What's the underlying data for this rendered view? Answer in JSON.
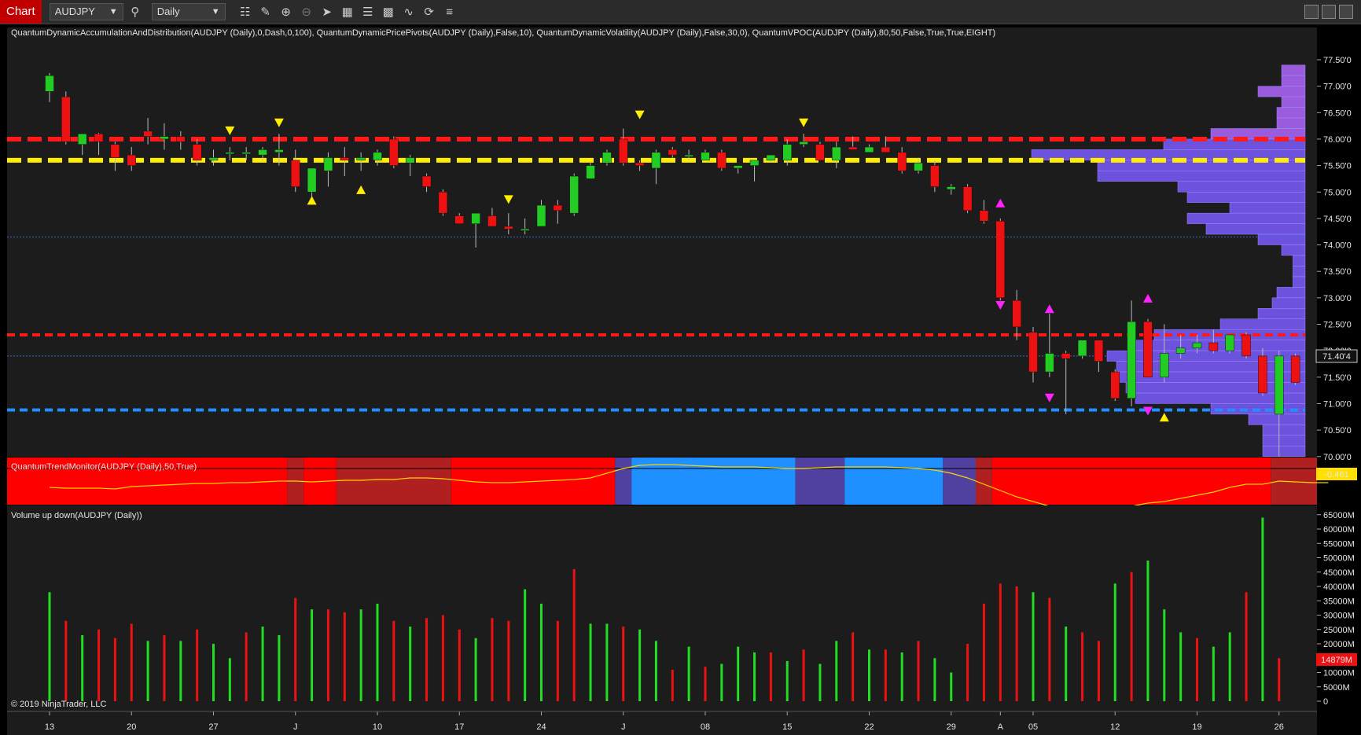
{
  "toolbar": {
    "tab_label": "Chart",
    "instrument": "AUDJPY",
    "period": "Daily"
  },
  "price_panel": {
    "indicator_text": "QuantumDynamicAccumulationAndDistribution(AUDJPY (Daily),0,Dash,0,100), QuantumDynamicPricePivots(AUDJPY (Daily),False,10), QuantumDynamicVolatility(AUDJPY (Daily),False,30,0), QuantumVPOC(AUDJPY (Daily),80,50,False,True,True,EIGHT)",
    "current_price_label": "71.40'4",
    "y_ticks": [
      "77.50'0",
      "77.00'0",
      "76.50'0",
      "76.00'0",
      "75.50'0",
      "75.00'0",
      "74.50'0",
      "74.00'0",
      "73.50'0",
      "73.00'0",
      "72.50'0",
      "72.00'0",
      "71.50'0",
      "71.00'0",
      "70.50'0",
      "70.00'0"
    ],
    "resistance_red": 76.0,
    "yellow_level": 75.6,
    "lower_red": 72.3,
    "blue_level": 70.88,
    "thin_blue_1": 74.15,
    "thin_blue_2": 71.9,
    "colors": {
      "up": "#22cc22",
      "down": "#ee1111",
      "red_line": "#ff1a1a",
      "yellow_line": "#ffee00",
      "blue_line": "#1e90ff",
      "vpoc": "#7b5cff",
      "vpoc_upper": "#b266ff"
    }
  },
  "trend_panel": {
    "title": "QuantumTrendMonitor(AUDJPY (Daily),50,True)",
    "value_label": "-0.461"
  },
  "volume_panel": {
    "title": "Volume up down(AUDJPY (Daily))",
    "copyright": "© 2019 NinjaTrader, LLC",
    "current_volume_label": "14879M",
    "y_ticks": [
      "65000M",
      "60000M",
      "55000M",
      "50000M",
      "45000M",
      "40000M",
      "35000M",
      "30000M",
      "25000M",
      "20000M",
      "15000M",
      "10000M",
      "5000M",
      "0"
    ]
  },
  "x_axis": {
    "labels": [
      "13",
      "20",
      "27",
      "J",
      "10",
      "17",
      "24",
      "J",
      "08",
      "15",
      "22",
      "29",
      "A",
      "05",
      "12",
      "19",
      "26"
    ]
  },
  "chart_data": {
    "type": "candlestick",
    "candles": [
      {
        "o": 76.9,
        "h": 77.25,
        "l": 76.7,
        "c": 77.2
      },
      {
        "o": 76.8,
        "h": 76.9,
        "l": 75.9,
        "c": 75.95
      },
      {
        "o": 75.9,
        "h": 76.1,
        "l": 75.7,
        "c": 76.1
      },
      {
        "o": 76.1,
        "h": 76.12,
        "l": 75.7,
        "c": 75.95
      },
      {
        "o": 75.9,
        "h": 75.95,
        "l": 75.4,
        "c": 75.65
      },
      {
        "o": 75.7,
        "h": 75.85,
        "l": 75.4,
        "c": 75.5
      },
      {
        "o": 76.15,
        "h": 76.4,
        "l": 75.9,
        "c": 76.05
      },
      {
        "o": 76.0,
        "h": 76.3,
        "l": 75.8,
        "c": 76.05
      },
      {
        "o": 76.05,
        "h": 76.15,
        "l": 75.8,
        "c": 75.95
      },
      {
        "o": 75.9,
        "h": 76.0,
        "l": 75.5,
        "c": 75.6
      },
      {
        "o": 75.6,
        "h": 75.8,
        "l": 75.5,
        "c": 75.65
      },
      {
        "o": 75.75,
        "h": 75.85,
        "l": 75.6,
        "c": 75.75
      },
      {
        "o": 75.75,
        "h": 75.85,
        "l": 75.6,
        "c": 75.75
      },
      {
        "o": 75.7,
        "h": 75.85,
        "l": 75.6,
        "c": 75.8
      },
      {
        "o": 75.75,
        "h": 76.1,
        "l": 75.5,
        "c": 75.8
      },
      {
        "o": 75.6,
        "h": 75.8,
        "l": 75.0,
        "c": 75.1
      },
      {
        "o": 75.0,
        "h": 75.45,
        "l": 74.85,
        "c": 75.45
      },
      {
        "o": 75.4,
        "h": 75.75,
        "l": 75.1,
        "c": 75.65
      },
      {
        "o": 75.65,
        "h": 75.85,
        "l": 75.3,
        "c": 75.6
      },
      {
        "o": 75.6,
        "h": 75.75,
        "l": 75.4,
        "c": 75.65
      },
      {
        "o": 75.6,
        "h": 75.8,
        "l": 75.5,
        "c": 75.75
      },
      {
        "o": 76.0,
        "h": 76.05,
        "l": 75.45,
        "c": 75.5
      },
      {
        "o": 75.55,
        "h": 75.7,
        "l": 75.3,
        "c": 75.65
      },
      {
        "o": 75.3,
        "h": 75.35,
        "l": 75.0,
        "c": 75.1
      },
      {
        "o": 75.0,
        "h": 75.05,
        "l": 74.55,
        "c": 74.6
      },
      {
        "o": 74.55,
        "h": 74.6,
        "l": 74.4,
        "c": 74.4
      },
      {
        "o": 74.4,
        "h": 74.6,
        "l": 73.95,
        "c": 74.6
      },
      {
        "o": 74.55,
        "h": 74.7,
        "l": 74.35,
        "c": 74.35
      },
      {
        "o": 74.35,
        "h": 74.6,
        "l": 74.2,
        "c": 74.3
      },
      {
        "o": 74.3,
        "h": 74.5,
        "l": 74.2,
        "c": 74.3
      },
      {
        "o": 74.35,
        "h": 74.85,
        "l": 74.35,
        "c": 74.75
      },
      {
        "o": 74.75,
        "h": 74.85,
        "l": 74.4,
        "c": 74.65
      },
      {
        "o": 74.6,
        "h": 75.35,
        "l": 74.55,
        "c": 75.3
      },
      {
        "o": 75.25,
        "h": 75.55,
        "l": 75.25,
        "c": 75.5
      },
      {
        "o": 75.55,
        "h": 75.8,
        "l": 75.5,
        "c": 75.75
      },
      {
        "o": 76.0,
        "h": 76.2,
        "l": 75.5,
        "c": 75.55
      },
      {
        "o": 75.55,
        "h": 75.6,
        "l": 75.4,
        "c": 75.5
      },
      {
        "o": 75.45,
        "h": 75.8,
        "l": 75.15,
        "c": 75.75
      },
      {
        "o": 75.8,
        "h": 75.85,
        "l": 75.65,
        "c": 75.7
      },
      {
        "o": 75.7,
        "h": 75.8,
        "l": 75.6,
        "c": 75.7
      },
      {
        "o": 75.6,
        "h": 75.8,
        "l": 75.6,
        "c": 75.75
      },
      {
        "o": 75.75,
        "h": 75.8,
        "l": 75.4,
        "c": 75.45
      },
      {
        "o": 75.45,
        "h": 75.5,
        "l": 75.35,
        "c": 75.5
      },
      {
        "o": 75.5,
        "h": 75.6,
        "l": 75.2,
        "c": 75.6
      },
      {
        "o": 75.6,
        "h": 75.7,
        "l": 75.55,
        "c": 75.7
      },
      {
        "o": 75.6,
        "h": 76.0,
        "l": 75.5,
        "c": 75.9
      },
      {
        "o": 75.9,
        "h": 76.1,
        "l": 75.85,
        "c": 75.95
      },
      {
        "o": 75.9,
        "h": 75.95,
        "l": 75.6,
        "c": 75.6
      },
      {
        "o": 75.6,
        "h": 75.95,
        "l": 75.45,
        "c": 75.85
      },
      {
        "o": 75.85,
        "h": 76.05,
        "l": 75.8,
        "c": 75.8
      },
      {
        "o": 75.75,
        "h": 75.9,
        "l": 75.75,
        "c": 75.85
      },
      {
        "o": 75.85,
        "h": 76.05,
        "l": 75.75,
        "c": 75.75
      },
      {
        "o": 75.75,
        "h": 75.85,
        "l": 75.35,
        "c": 75.4
      },
      {
        "o": 75.4,
        "h": 75.65,
        "l": 75.35,
        "c": 75.55
      },
      {
        "o": 75.5,
        "h": 75.6,
        "l": 75.0,
        "c": 75.1
      },
      {
        "o": 75.05,
        "h": 75.15,
        "l": 74.95,
        "c": 75.1
      },
      {
        "o": 75.1,
        "h": 75.15,
        "l": 74.6,
        "c": 74.65
      },
      {
        "o": 74.65,
        "h": 74.85,
        "l": 74.4,
        "c": 74.45
      },
      {
        "o": 74.45,
        "h": 74.5,
        "l": 72.95,
        "c": 73.0
      },
      {
        "o": 72.95,
        "h": 73.15,
        "l": 72.2,
        "c": 72.45
      },
      {
        "o": 72.35,
        "h": 72.45,
        "l": 71.4,
        "c": 71.6
      },
      {
        "o": 71.6,
        "h": 72.7,
        "l": 71.5,
        "c": 71.95
      },
      {
        "o": 71.95,
        "h": 72.0,
        "l": 70.8,
        "c": 71.85
      },
      {
        "o": 71.9,
        "h": 72.2,
        "l": 71.85,
        "c": 72.2
      },
      {
        "o": 72.2,
        "h": 72.2,
        "l": 71.6,
        "c": 71.8
      },
      {
        "o": 71.6,
        "h": 71.65,
        "l": 71.05,
        "c": 71.1
      },
      {
        "o": 71.1,
        "h": 72.95,
        "l": 70.95,
        "c": 72.55
      },
      {
        "o": 72.55,
        "h": 72.6,
        "l": 71.5,
        "c": 71.5
      },
      {
        "o": 71.5,
        "h": 72.5,
        "l": 71.4,
        "c": 71.95
      },
      {
        "o": 71.95,
        "h": 72.3,
        "l": 71.85,
        "c": 72.05
      },
      {
        "o": 72.05,
        "h": 72.3,
        "l": 71.95,
        "c": 72.15
      },
      {
        "o": 72.15,
        "h": 72.4,
        "l": 71.95,
        "c": 72.0
      },
      {
        "o": 72.0,
        "h": 72.3,
        "l": 71.95,
        "c": 72.3
      },
      {
        "o": 72.3,
        "h": 72.35,
        "l": 71.85,
        "c": 71.9
      },
      {
        "o": 71.9,
        "h": 72.05,
        "l": 71.15,
        "c": 71.2
      },
      {
        "o": 70.8,
        "h": 72.0,
        "l": 70.0,
        "c": 71.9
      },
      {
        "o": 71.9,
        "h": 71.95,
        "l": 71.35,
        "c": 71.4
      }
    ],
    "volume_k": [
      38,
      28,
      23,
      25,
      22,
      27,
      21,
      23,
      21,
      25,
      20,
      15,
      24,
      26,
      23,
      36,
      32,
      32,
      31,
      32,
      34,
      28,
      26,
      29,
      30,
      25,
      22,
      29,
      28,
      39,
      34,
      28,
      46,
      27,
      27,
      26,
      25,
      21,
      11,
      19,
      12,
      13,
      19,
      17,
      17,
      14,
      18,
      13,
      21,
      24,
      18,
      18,
      17,
      21,
      15,
      10,
      20,
      34,
      41,
      40,
      38,
      36,
      26,
      24,
      21,
      41,
      45,
      49,
      32,
      24,
      22,
      19,
      24,
      38,
      64,
      15
    ],
    "volume_up": [
      1,
      0,
      1,
      0,
      0,
      0,
      1,
      0,
      1,
      0,
      1,
      1,
      0,
      1,
      1,
      0,
      1,
      0,
      0,
      1,
      1,
      0,
      1,
      0,
      0,
      0,
      1,
      0,
      0,
      1,
      1,
      0,
      0,
      1,
      1,
      0,
      1,
      1,
      0,
      1,
      0,
      1,
      1,
      1,
      0,
      1,
      0,
      1,
      1,
      0,
      1,
      0,
      1,
      0,
      1,
      1,
      0,
      0,
      0,
      0,
      1,
      0,
      1,
      0,
      0,
      1,
      0,
      1,
      1,
      1,
      0,
      1,
      1,
      0,
      1,
      0
    ],
    "vpoc_profile": [
      {
        "p": 77.3,
        "w": 0.25
      },
      {
        "p": 77.1,
        "w": 0.25
      },
      {
        "p": 76.9,
        "w": 0.5
      },
      {
        "p": 76.7,
        "w": 0.25
      },
      {
        "p": 76.5,
        "w": 0.3
      },
      {
        "p": 76.3,
        "w": 0.3
      },
      {
        "p": 76.1,
        "w": 1.0
      },
      {
        "p": 75.9,
        "w": 1.5
      },
      {
        "p": 75.7,
        "w": 2.9
      },
      {
        "p": 75.5,
        "w": 2.2
      },
      {
        "p": 75.3,
        "w": 2.2
      },
      {
        "p": 75.1,
        "w": 1.35
      },
      {
        "p": 74.9,
        "w": 1.25
      },
      {
        "p": 74.7,
        "w": 0.8
      },
      {
        "p": 74.5,
        "w": 1.25
      },
      {
        "p": 74.3,
        "w": 1.05
      },
      {
        "p": 74.1,
        "w": 0.5
      },
      {
        "p": 73.9,
        "w": 0.25
      },
      {
        "p": 73.7,
        "w": 0.13
      },
      {
        "p": 73.5,
        "w": 0.13
      },
      {
        "p": 73.3,
        "w": 0.13
      },
      {
        "p": 73.1,
        "w": 0.3
      },
      {
        "p": 72.9,
        "w": 0.35
      },
      {
        "p": 72.7,
        "w": 0.5
      },
      {
        "p": 72.5,
        "w": 0.9
      },
      {
        "p": 72.3,
        "w": 1.6
      },
      {
        "p": 72.1,
        "w": 1.8
      },
      {
        "p": 71.9,
        "w": 2.1
      },
      {
        "p": 71.7,
        "w": 2.0
      },
      {
        "p": 71.5,
        "w": 2.0
      },
      {
        "p": 71.3,
        "w": 1.9
      },
      {
        "p": 71.1,
        "w": 1.8
      },
      {
        "p": 70.9,
        "w": 1.0
      },
      {
        "p": 70.7,
        "w": 0.6
      },
      {
        "p": 70.5,
        "w": 0.45
      },
      {
        "p": 70.3,
        "w": 0.45
      },
      {
        "p": 70.1,
        "w": 0.45
      }
    ],
    "pivots_up_yellow": [
      {
        "i": 16,
        "p": 74.85
      },
      {
        "i": 19,
        "p": 75.05
      },
      {
        "i": 68,
        "p": 70.75
      }
    ],
    "pivots_down_yellow": [
      {
        "i": 11,
        "p": 76.15
      },
      {
        "i": 14,
        "p": 76.3
      },
      {
        "i": 28,
        "p": 74.85
      },
      {
        "i": 36,
        "p": 76.45
      },
      {
        "i": 46,
        "p": 76.3
      }
    ],
    "pivots_up_magenta": [
      {
        "i": 58,
        "p": 74.8
      },
      {
        "i": 61,
        "p": 72.8
      },
      {
        "i": 67,
        "p": 73.0
      }
    ],
    "pivots_down_magenta": [
      {
        "i": 58,
        "p": 72.85
      },
      {
        "i": 61,
        "p": 71.1
      },
      {
        "i": 67,
        "p": 70.85
      }
    ],
    "trend_segments": [
      {
        "from": 0,
        "to": 15,
        "color": "#ff0000"
      },
      {
        "from": 15,
        "to": 16,
        "color": "#b02020"
      },
      {
        "from": 16,
        "to": 18,
        "color": "#ff0000"
      },
      {
        "from": 18,
        "to": 25,
        "color": "#b02020"
      },
      {
        "from": 25,
        "to": 35,
        "color": "#ff0000"
      },
      {
        "from": 35,
        "to": 36,
        "color": "#5040a0"
      },
      {
        "from": 36,
        "to": 46,
        "color": "#1e90ff"
      },
      {
        "from": 46,
        "to": 49,
        "color": "#5040a0"
      },
      {
        "from": 49,
        "to": 55,
        "color": "#1e90ff"
      },
      {
        "from": 55,
        "to": 57,
        "color": "#5040a0"
      },
      {
        "from": 57,
        "to": 58,
        "color": "#b02020"
      },
      {
        "from": 58,
        "to": 75,
        "color": "#ff0000"
      },
      {
        "from": 75,
        "to": 79,
        "color": "#b02020"
      }
    ],
    "trend_line": [
      0.4,
      0.35,
      0.35,
      0.35,
      0.3,
      0.45,
      0.5,
      0.55,
      0.6,
      0.65,
      0.65,
      0.7,
      0.7,
      0.75,
      0.8,
      0.8,
      0.75,
      0.8,
      0.85,
      0.85,
      0.9,
      0.9,
      1.0,
      1.0,
      0.95,
      0.85,
      0.75,
      0.7,
      0.7,
      0.75,
      0.8,
      0.85,
      0.9,
      1.0,
      1.3,
      1.6,
      1.8,
      1.85,
      1.85,
      1.8,
      1.75,
      1.7,
      1.7,
      1.7,
      1.65,
      1.6,
      1.6,
      1.65,
      1.7,
      1.7,
      1.7,
      1.7,
      1.65,
      1.6,
      1.5,
      1.3,
      1.0,
      0.6,
      0.2,
      -0.2,
      -0.5,
      -0.8,
      -1.0,
      -1.1,
      -1.0,
      -0.9,
      -0.8,
      -0.6,
      -0.5,
      -0.3,
      -0.1,
      0.1,
      0.4,
      0.6,
      0.6,
      0.8,
      0.75,
      0.7,
      0.7
    ]
  }
}
